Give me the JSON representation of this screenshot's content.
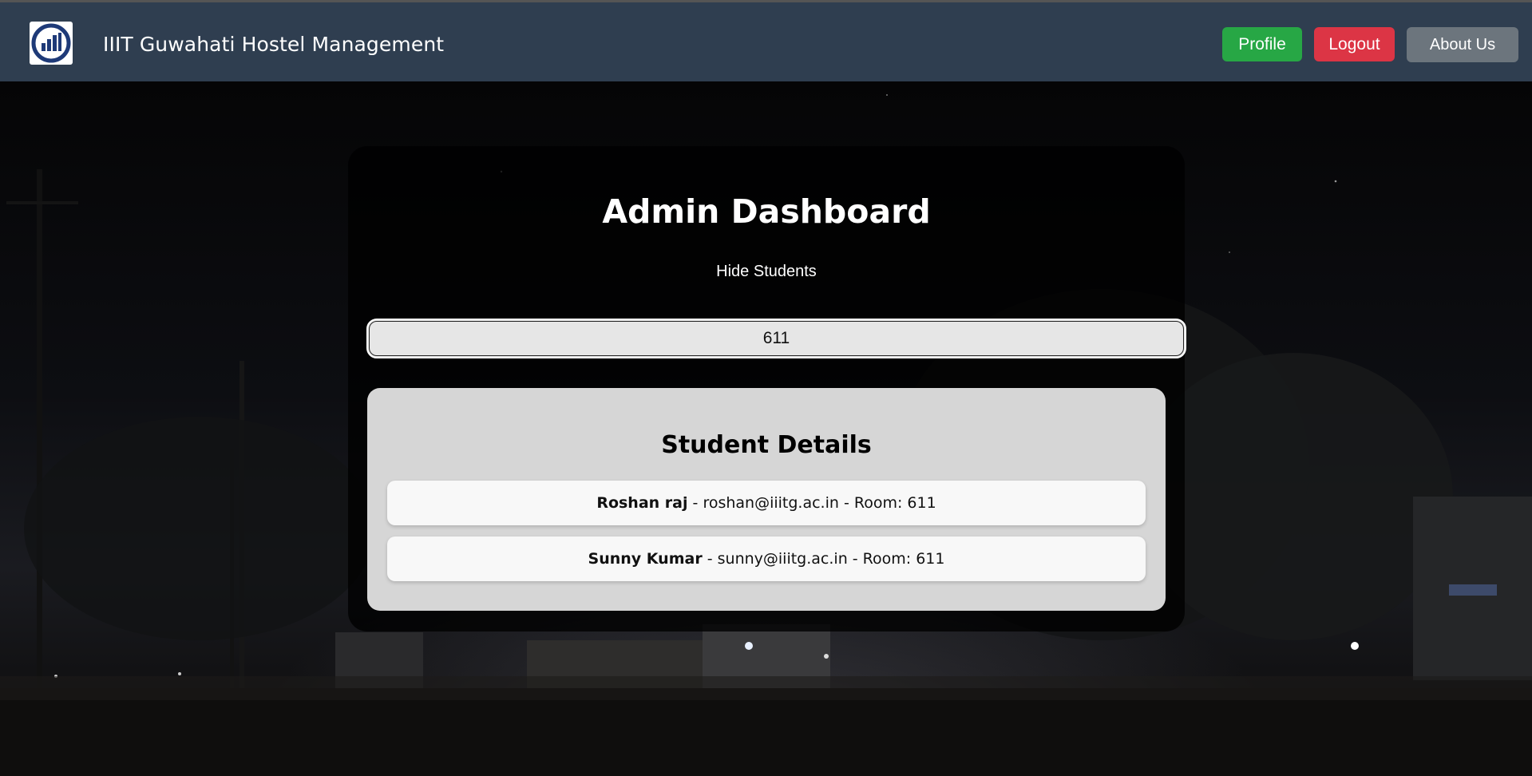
{
  "navbar": {
    "brand": "IIIT Guwahati Hostel Management",
    "buttons": {
      "profile": "Profile",
      "logout": "Logout",
      "about": "About Us"
    }
  },
  "dashboard": {
    "title": "Admin Dashboard",
    "toggle_label": "Hide Students",
    "search_value": "611"
  },
  "student_details": {
    "title": "Student Details",
    "students": [
      {
        "name": "Roshan raj",
        "email": "roshan@iiitg.ac.in",
        "room_label": "Room: 611"
      },
      {
        "name": "Sunny Kumar",
        "email": "sunny@iiitg.ac.in",
        "room_label": "Room: 611"
      }
    ],
    "separator": " - "
  },
  "colors": {
    "navbar": "#2f3e50",
    "profile": "#27a745",
    "logout": "#dc3545",
    "about": "#6c757d"
  }
}
